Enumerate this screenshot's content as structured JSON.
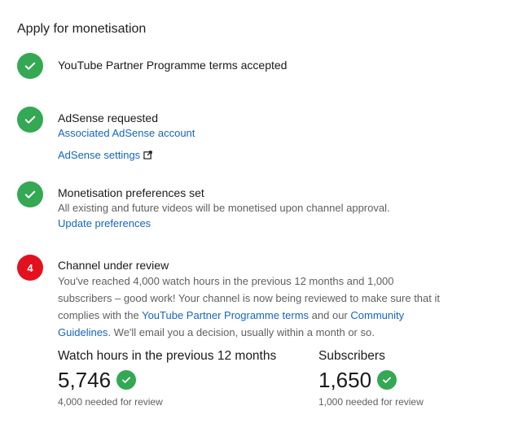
{
  "heading": "Apply for monetisation",
  "steps": [
    {
      "title": "YouTube Partner Programme terms accepted",
      "status": "check-icon"
    },
    {
      "title": "AdSense requested",
      "links": [
        "Associated AdSense account",
        "AdSense settings"
      ],
      "status": "check-icon"
    },
    {
      "title": "Monetisation preferences set",
      "description": "All existing and future videos will be monetised upon channel approval.",
      "link": "Update preferences",
      "status": "check-icon"
    },
    {
      "number": "4",
      "title": "Channel under review",
      "description_line1": "You've reached 4,000 watch hours in the previous 12 months and 1,000",
      "description_line2": "subscribers – good work! Your channel is now being reviewed to make sure that it",
      "description_line3_a": "complies with the ",
      "description_link1": "YouTube Partner Programme terms",
      "description_line3_b": " and our ",
      "description_link2a": "Community",
      "description_link2b": "Guidelines",
      "description_line4": ". We'll email you a decision, usually within a month or so."
    }
  ],
  "stats": {
    "watch": {
      "label": "Watch hours in the previous 12 months",
      "value": "5,746",
      "needed": "4,000 needed for review"
    },
    "subs": {
      "label": "Subscribers",
      "value": "1,650",
      "needed": "1,000 needed for review"
    }
  },
  "colors": {
    "success": "#34a853",
    "error": "#e3111e",
    "link": "#1565c0"
  }
}
